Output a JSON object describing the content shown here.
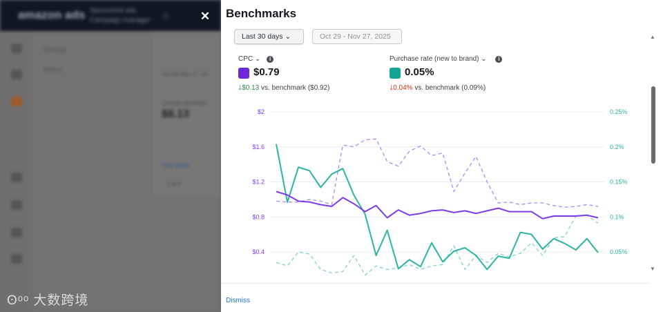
{
  "background": {
    "brand": "amazon ads",
    "subtitle_1": "Sponsored ads",
    "subtitle_2": "Campaign manager",
    "nav": [
      "Settings",
      "History"
    ],
    "card_metric_label": "Cost per purchase",
    "card_metric_value": "$8.13",
    "card_date": "Oct 29–Nov 27, 20",
    "card_link": "View details",
    "card_pager": "5 of 9"
  },
  "watermark": "大数跨境",
  "panel": {
    "title": "Benchmarks",
    "range_label": "Last 30 days",
    "date_range": "Oct 29 - Nov 27, 2025",
    "dismiss": "Dismiss",
    "metrics": [
      {
        "label": "CPC",
        "value": "$0.79",
        "delta": "$0.13",
        "delta_direction": "down",
        "delta_color": "#2e8540",
        "comparison": "vs. benchmark ($0.92)",
        "color": "#6d28d9"
      },
      {
        "label": "Purchase rate (new to brand)",
        "value": "0.05%",
        "delta": "0.04%",
        "delta_direction": "down",
        "delta_color": "#d13212",
        "comparison": "vs. benchmark (0.09%)",
        "color": "#14a394"
      }
    ]
  },
  "chart_data": {
    "type": "line",
    "grid": true,
    "left_axis": {
      "ticks": [
        "$2",
        "$1.6",
        "$1.2",
        "$0.8",
        "$0.4"
      ],
      "tick_values": [
        2,
        1.6,
        1.2,
        0.8,
        0.4
      ],
      "color": "#7c3aed"
    },
    "right_axis": {
      "ticks": [
        "0.25%",
        "0.2%",
        "0.15%",
        "0.1%",
        "0.05%"
      ],
      "tick_values": [
        0.25,
        0.2,
        0.15,
        0.1,
        0.05
      ],
      "color": "#2bb3a3"
    },
    "series": [
      {
        "axis": "left",
        "style": "solid",
        "color": "#7c3aed",
        "values": [
          1.09,
          1.05,
          0.98,
          0.97,
          0.94,
          0.92,
          1.02,
          0.95,
          0.86,
          0.93,
          0.79,
          0.88,
          0.82,
          0.84,
          0.87,
          0.88,
          0.85,
          0.87,
          0.84,
          0.87,
          0.9,
          0.86,
          0.86,
          0.86,
          0.78,
          0.81,
          0.81,
          0.81,
          0.82,
          0.79
        ]
      },
      {
        "axis": "left",
        "style": "dashed",
        "color": "#a78bfa",
        "values": [
          0.98,
          0.97,
          0.97,
          1.0,
          0.98,
          0.94,
          1.62,
          1.6,
          1.68,
          1.69,
          1.43,
          1.38,
          1.55,
          1.61,
          1.5,
          1.53,
          1.09,
          1.3,
          1.49,
          1.2,
          0.96,
          0.97,
          0.94,
          0.96,
          0.96,
          0.93,
          0.91,
          0.92,
          0.94,
          0.92
        ]
      },
      {
        "axis": "right",
        "style": "solid",
        "color": "#2bb3a3",
        "values": [
          0.204,
          0.121,
          0.171,
          0.166,
          0.142,
          0.161,
          0.169,
          0.131,
          0.104,
          0.045,
          0.081,
          0.026,
          0.039,
          0.029,
          0.063,
          0.036,
          0.051,
          0.056,
          0.045,
          0.025,
          0.044,
          0.041,
          0.078,
          0.075,
          0.054,
          0.069,
          0.062,
          0.053,
          0.069,
          0.049
        ]
      },
      {
        "axis": "right",
        "style": "dashed",
        "color": "#7fd3c8",
        "values": [
          0.035,
          0.03,
          0.05,
          0.047,
          0.025,
          0.02,
          0.022,
          0.045,
          0.017,
          0.03,
          0.025,
          0.027,
          0.032,
          0.025,
          0.03,
          0.032,
          0.059,
          0.025,
          0.045,
          0.035,
          0.048,
          0.043,
          0.048,
          0.063,
          0.045,
          0.07,
          0.072,
          0.102,
          0.102,
          0.091
        ]
      }
    ]
  }
}
